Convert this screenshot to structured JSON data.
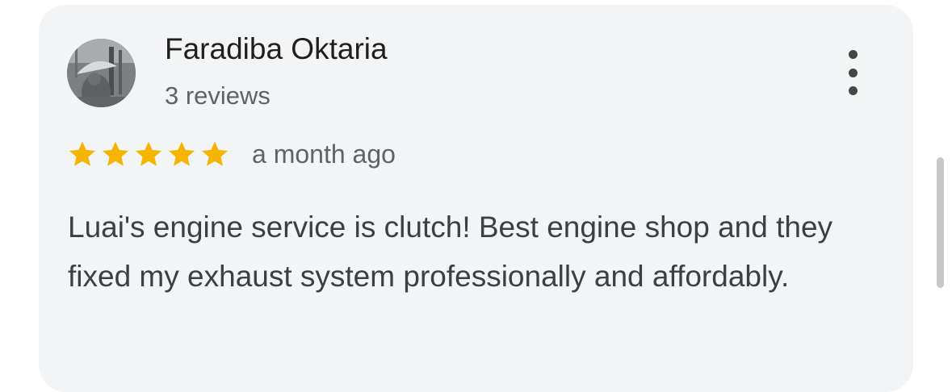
{
  "review": {
    "author_name": "Faradiba Oktaria",
    "author_meta": "3 reviews",
    "rating": 5,
    "rating_max": 5,
    "date": "a month ago",
    "text": "Luai's engine service is clutch! Best engine shop and they fixed my exhaust system professionally and affordably."
  },
  "icons": {
    "star": "star-icon",
    "more": "more-vert-icon",
    "avatar": "profile-photo"
  },
  "colors": {
    "card_background": "#f3f4f6",
    "star": "#f4b400",
    "primary_text": "#1f1f1f",
    "secondary_text": "#5f6368"
  }
}
